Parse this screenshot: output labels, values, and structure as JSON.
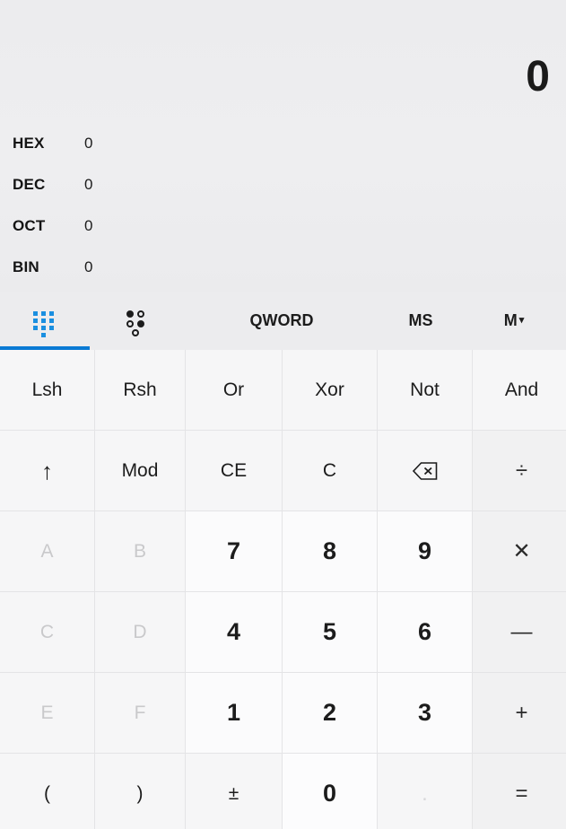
{
  "display": {
    "main_result": "0",
    "radix": [
      {
        "label": "HEX",
        "value": "0"
      },
      {
        "label": "DEC",
        "value": "0"
      },
      {
        "label": "OCT",
        "value": "0"
      },
      {
        "label": "BIN",
        "value": "0"
      }
    ]
  },
  "toolbar": {
    "keypad_icon": "keypad-grid-icon",
    "bit_toggle_icon": "bit-toggle-icon",
    "word_size_label": "QWORD",
    "memory_store_label": "MS",
    "memory_label": "M",
    "memory_chevron": "▾",
    "active_tab": "keypad",
    "accent_color": "#0a7ad4"
  },
  "keypad": {
    "rows": [
      [
        {
          "name": "lsh",
          "label": "Lsh",
          "kind": "func",
          "enabled": true
        },
        {
          "name": "rsh",
          "label": "Rsh",
          "kind": "func",
          "enabled": true
        },
        {
          "name": "or",
          "label": "Or",
          "kind": "func",
          "enabled": true
        },
        {
          "name": "xor",
          "label": "Xor",
          "kind": "func",
          "enabled": true
        },
        {
          "name": "not",
          "label": "Not",
          "kind": "func",
          "enabled": true
        },
        {
          "name": "and",
          "label": "And",
          "kind": "func",
          "enabled": true
        }
      ],
      [
        {
          "name": "shift-up",
          "label": "↑",
          "kind": "func",
          "enabled": true
        },
        {
          "name": "mod",
          "label": "Mod",
          "kind": "func",
          "enabled": true
        },
        {
          "name": "clear-entry",
          "label": "CE",
          "kind": "func",
          "enabled": true
        },
        {
          "name": "clear",
          "label": "C",
          "kind": "func",
          "enabled": true
        },
        {
          "name": "backspace",
          "label": "",
          "kind": "backspace",
          "enabled": true
        },
        {
          "name": "divide",
          "label": "÷",
          "kind": "op",
          "enabled": true
        }
      ],
      [
        {
          "name": "hex-a",
          "label": "A",
          "kind": "hex",
          "enabled": false
        },
        {
          "name": "hex-b",
          "label": "B",
          "kind": "hex",
          "enabled": false
        },
        {
          "name": "digit-7",
          "label": "7",
          "kind": "number",
          "enabled": true
        },
        {
          "name": "digit-8",
          "label": "8",
          "kind": "number",
          "enabled": true
        },
        {
          "name": "digit-9",
          "label": "9",
          "kind": "number",
          "enabled": true
        },
        {
          "name": "multiply",
          "label": "✕",
          "kind": "op",
          "enabled": true
        }
      ],
      [
        {
          "name": "hex-c",
          "label": "C",
          "kind": "hex",
          "enabled": false
        },
        {
          "name": "hex-d",
          "label": "D",
          "kind": "hex",
          "enabled": false
        },
        {
          "name": "digit-4",
          "label": "4",
          "kind": "number",
          "enabled": true
        },
        {
          "name": "digit-5",
          "label": "5",
          "kind": "number",
          "enabled": true
        },
        {
          "name": "digit-6",
          "label": "6",
          "kind": "number",
          "enabled": true
        },
        {
          "name": "subtract",
          "label": "—",
          "kind": "op",
          "enabled": true
        }
      ],
      [
        {
          "name": "hex-e",
          "label": "E",
          "kind": "hex",
          "enabled": false
        },
        {
          "name": "hex-f",
          "label": "F",
          "kind": "hex",
          "enabled": false
        },
        {
          "name": "digit-1",
          "label": "1",
          "kind": "number",
          "enabled": true
        },
        {
          "name": "digit-2",
          "label": "2",
          "kind": "number",
          "enabled": true
        },
        {
          "name": "digit-3",
          "label": "3",
          "kind": "number",
          "enabled": true
        },
        {
          "name": "add",
          "label": "+",
          "kind": "op",
          "enabled": true
        }
      ],
      [
        {
          "name": "paren-open",
          "label": "(",
          "kind": "func",
          "enabled": true
        },
        {
          "name": "paren-close",
          "label": ")",
          "kind": "func",
          "enabled": true
        },
        {
          "name": "plus-minus",
          "label": "±",
          "kind": "func",
          "enabled": true
        },
        {
          "name": "digit-0",
          "label": "0",
          "kind": "zero",
          "enabled": true
        },
        {
          "name": "decimal-point",
          "label": ".",
          "kind": "dot",
          "enabled": false
        },
        {
          "name": "equals",
          "label": "=",
          "kind": "equals",
          "enabled": true
        }
      ]
    ]
  }
}
